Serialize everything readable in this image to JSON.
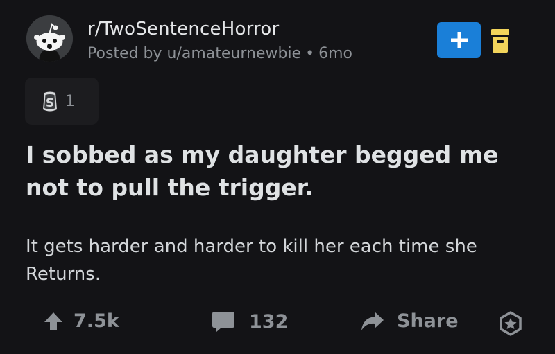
{
  "post": {
    "subreddit": "r/TwoSentenceHorror",
    "posted_by": "Posted by u/amateurnewbie",
    "age": "6mo",
    "award_count": "1",
    "title": "I sobbed as my daughter begged me not to pull the trigger.",
    "body": "It gets harder and harder to kill her each time she Returns."
  },
  "actions": {
    "upvotes": "7.5k",
    "comments": "132",
    "share_label": "Share"
  },
  "colors": {
    "background": "#131316",
    "join_button": "#1a7fd8",
    "save_icon": "#f2d45b",
    "muted_text": "#8e9297"
  },
  "icons": {
    "join": "plus-icon",
    "save": "archive-icon",
    "award": "silver-award-icon",
    "upvote": "upvote-arrow-icon",
    "comment": "comment-bubble-icon",
    "share": "share-arrow-icon",
    "give_award": "award-star-icon"
  }
}
